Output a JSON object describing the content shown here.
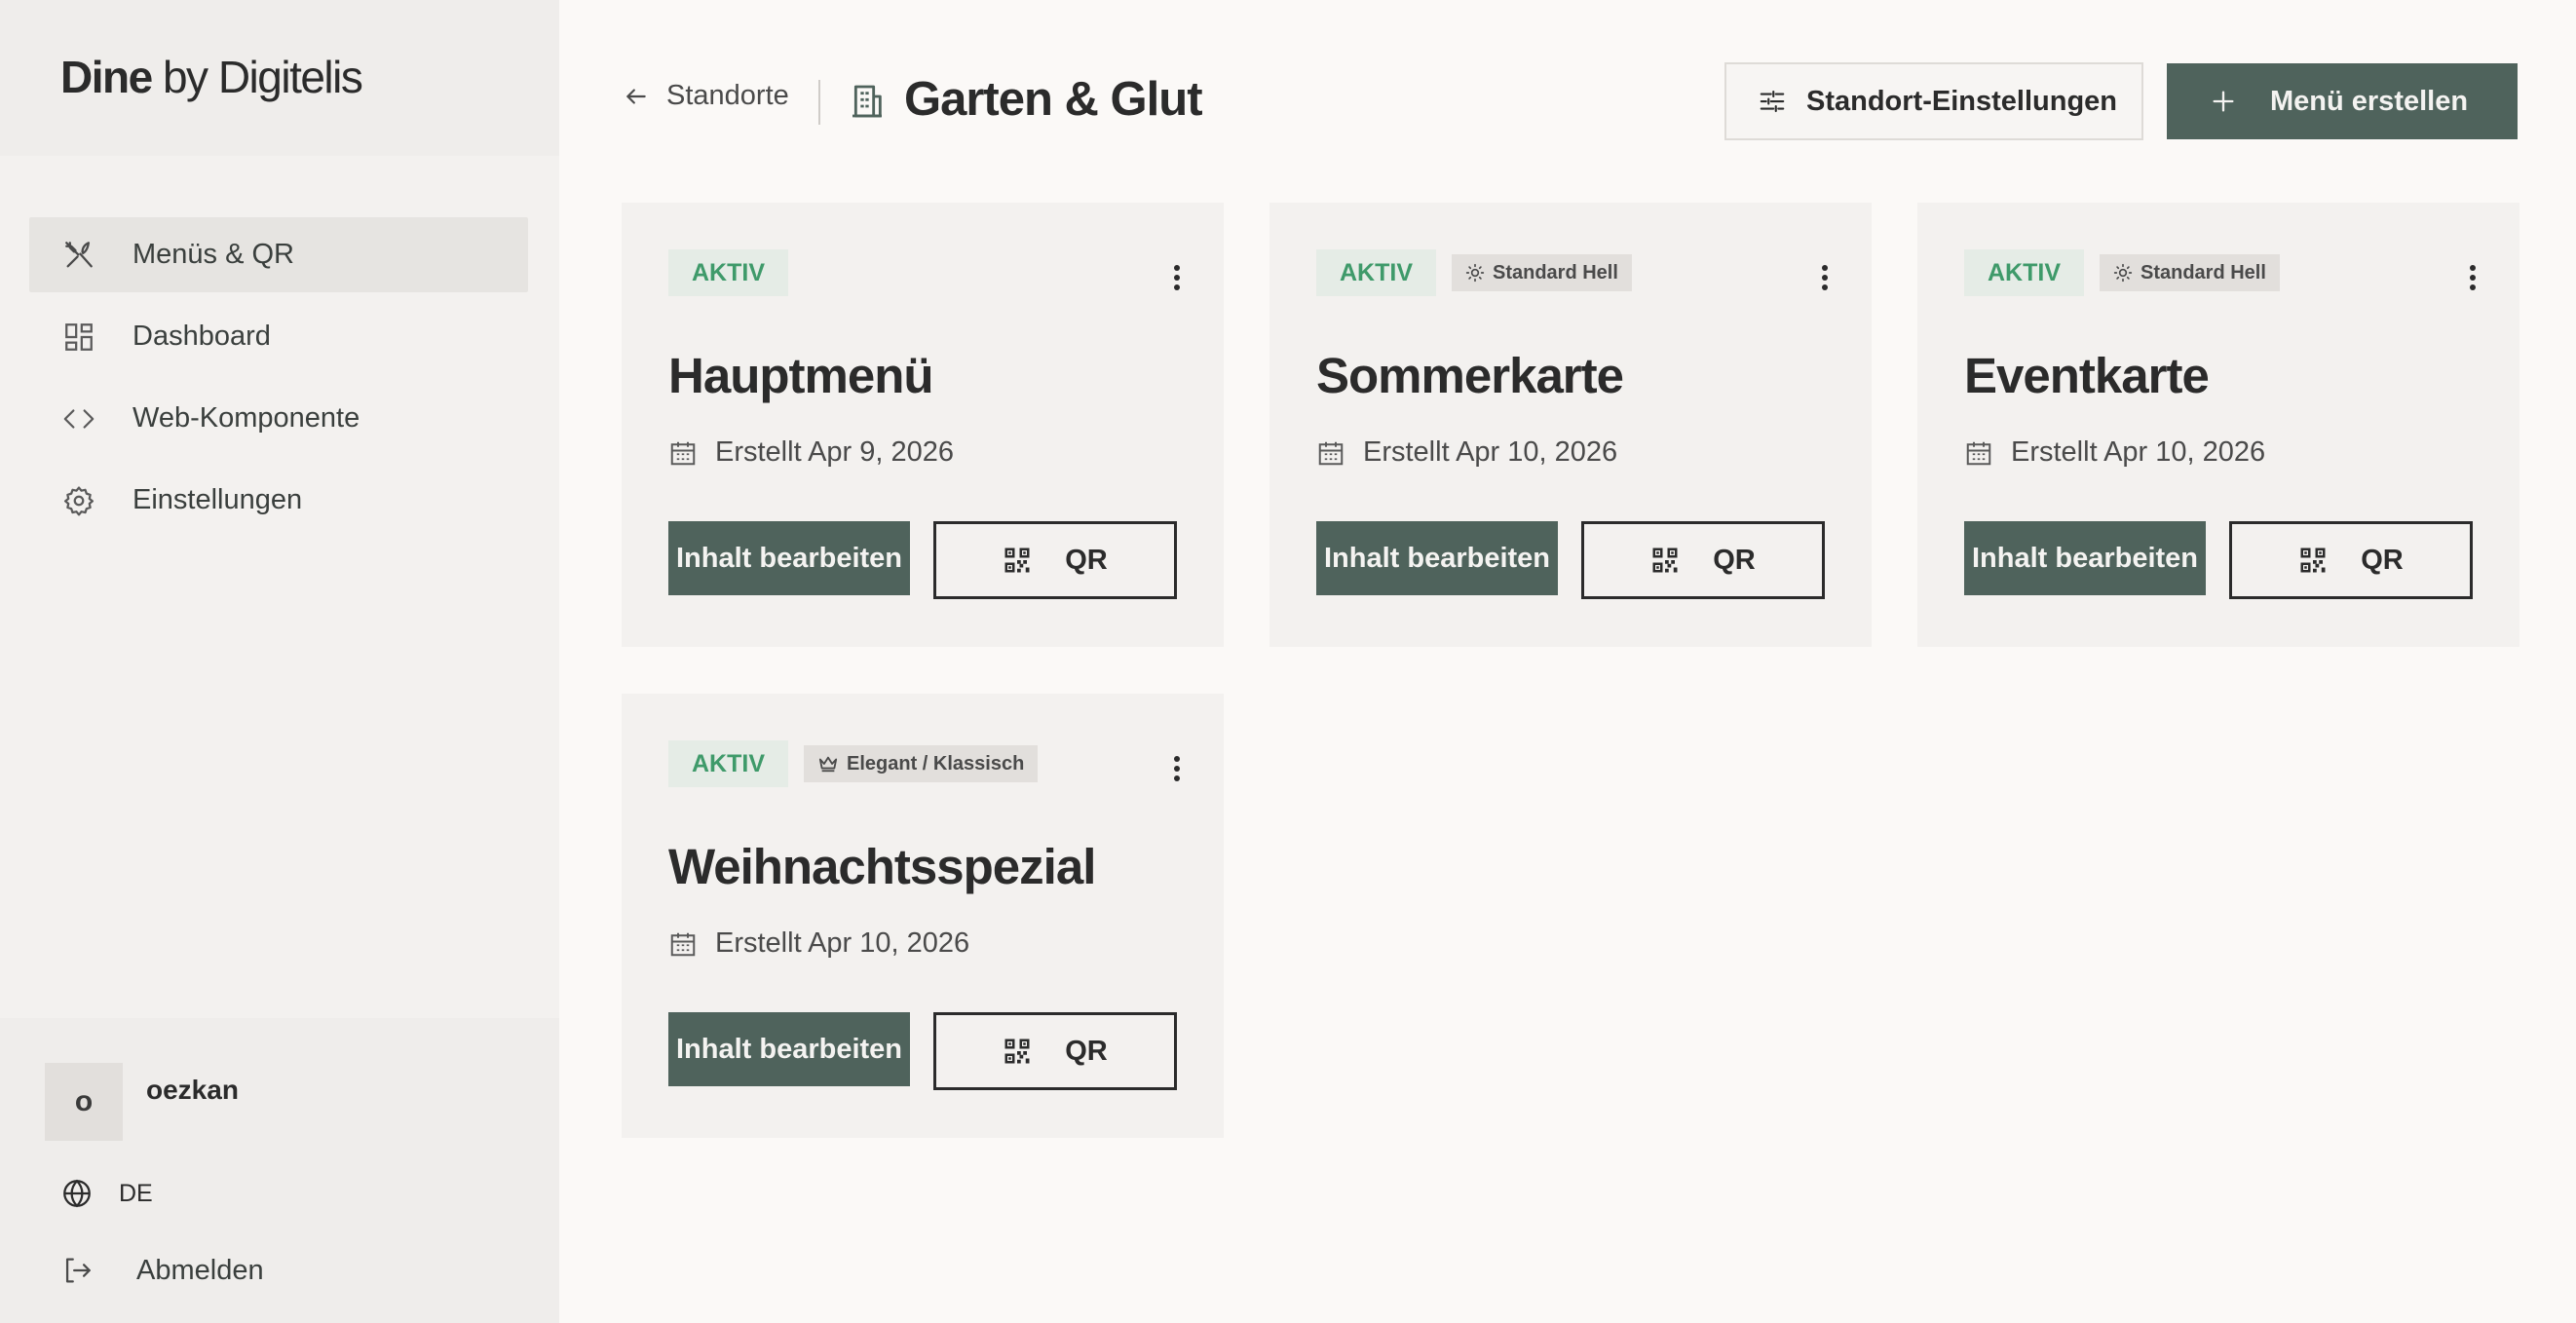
{
  "brand": {
    "name_bold": "Dine",
    "name_rest": " by Digitelis"
  },
  "sidebar": {
    "items": [
      {
        "label": "Menüs & QR",
        "icon": "utensils-icon",
        "active": true
      },
      {
        "label": "Dashboard",
        "icon": "dashboard-icon",
        "active": false
      },
      {
        "label": "Web-Komponente",
        "icon": "code-icon",
        "active": false
      },
      {
        "label": "Einstellungen",
        "icon": "gear-icon",
        "active": false
      }
    ],
    "user": {
      "initial": "o",
      "name": "oezkan"
    },
    "language": "DE",
    "logout_label": "Abmelden"
  },
  "header": {
    "back_label": "Standorte",
    "title": "Garten & Glut",
    "settings_label": "Standort-Einstellungen",
    "create_label": "Menü erstellen"
  },
  "menus": [
    {
      "status": "AKTIV",
      "theme": "",
      "theme_icon": "",
      "title": "Hauptmenü",
      "created": "Erstellt Apr 9, 2026",
      "edit_label": "Inhalt bearbeiten",
      "qr_label": "QR"
    },
    {
      "status": "AKTIV",
      "theme": "Standard Hell",
      "theme_icon": "sun-icon",
      "title": "Sommerkarte",
      "created": "Erstellt Apr 10, 2026",
      "edit_label": "Inhalt bearbeiten",
      "qr_label": "QR"
    },
    {
      "status": "AKTIV",
      "theme": "Standard Hell",
      "theme_icon": "sun-icon",
      "title": "Eventkarte",
      "created": "Erstellt Apr 10, 2026",
      "edit_label": "Inhalt bearbeiten",
      "qr_label": "QR"
    },
    {
      "status": "AKTIV",
      "theme": "Elegant / Klassisch",
      "theme_icon": "crown-icon",
      "title": "Weihnachtsspezial",
      "created": "Erstellt Apr 10, 2026",
      "edit_label": "Inhalt bearbeiten",
      "qr_label": "QR"
    }
  ],
  "colors": {
    "primary": "#4f635c",
    "active_badge_bg": "#e5ece6",
    "active_badge_text": "#3f9a6a",
    "page_bg": "#fbf9f7",
    "sidebar_bg": "#f3f1ef"
  }
}
